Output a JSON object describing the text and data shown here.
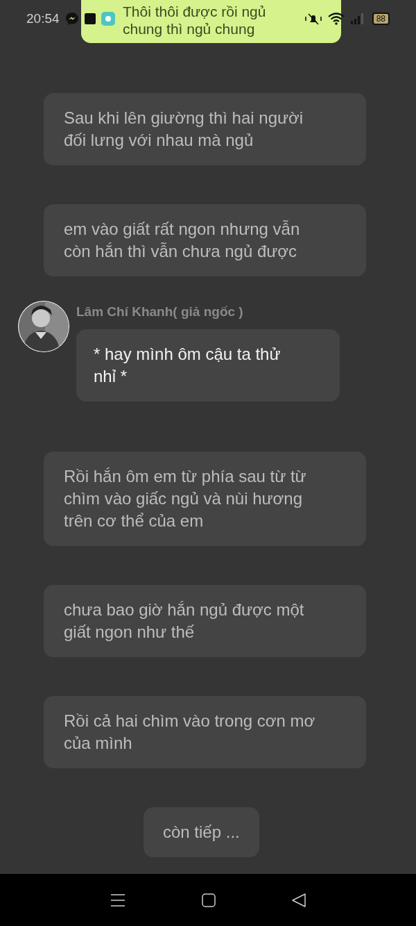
{
  "status_bar": {
    "time": "20:54",
    "battery": "88"
  },
  "notification": {
    "lines": [
      "Thôi thôi được rồi ngủ",
      "chung thì ngủ chung"
    ]
  },
  "messages": [
    {
      "kind": "narration",
      "text": "Sau khi lên giường thì hai người đối lưng với nhau mà ngủ"
    },
    {
      "kind": "narration",
      "text": "em vào giất rất ngon nhưng vẫn còn hắn thì vẫn chưa ngủ được"
    },
    {
      "kind": "character",
      "name": "Lâm Chí Khanh( giả ngốc )",
      "text": "* hay mình ôm cậu ta thử nhỉ *"
    },
    {
      "kind": "narration",
      "text": "Rồi hắn ôm em từ phía sau từ từ chìm vào giấc ngủ và nùi hương trên cơ thể của em"
    },
    {
      "kind": "narration",
      "text": "chưa bao giờ hắn ngủ được một giất ngon như thế"
    },
    {
      "kind": "narration",
      "text": "Rồi cả hai chìm vào trong cơn mơ của mình"
    }
  ],
  "continue_button": "còn tiếp ..."
}
